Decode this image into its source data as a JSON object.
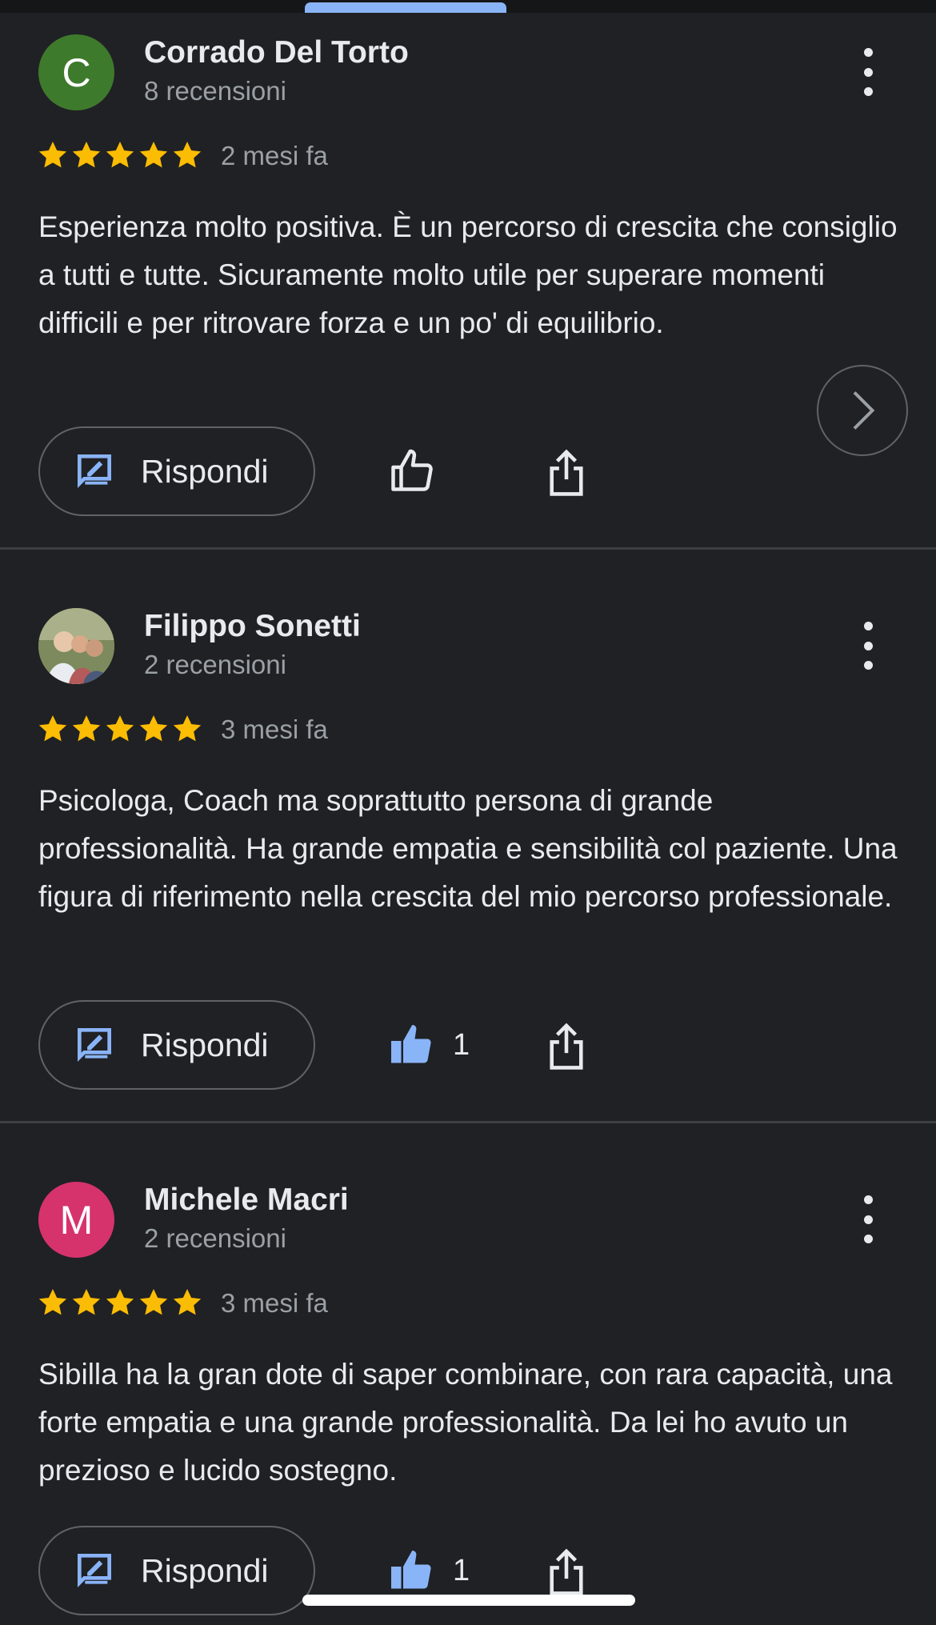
{
  "reviews": [
    {
      "name": "Corrado Del Torto",
      "subtitle": "8 recensioni",
      "avatar_letter": "C",
      "avatar_color": "#3e7a2c",
      "rating": 5,
      "date": "2 mesi fa",
      "text": "Esperienza molto positiva. È un percorso di crescita che consiglio a tutti e tutte. Sicuramente molto utile per superare momenti difficili e per ritrovare forza e un po' di equilibrio.",
      "reply_label": "Rispondi",
      "liked": false,
      "like_count": ""
    },
    {
      "name": "Filippo Sonetti",
      "subtitle": "2 recensioni",
      "avatar_letter": "",
      "avatar_color": "#8b7a5a",
      "rating": 5,
      "date": "3 mesi fa",
      "text": "Psicologa, Coach ma soprattutto persona di grande professionalità. Ha grande empatia e sensibilità col paziente. Una figura di riferimento nella crescita del mio percorso professionale.",
      "reply_label": "Rispondi",
      "liked": true,
      "like_count": "1"
    },
    {
      "name": "Michele Macri",
      "subtitle": "2 recensioni",
      "avatar_letter": "M",
      "avatar_color": "#d6336c",
      "rating": 5,
      "date": "3 mesi fa",
      "text": "Sibilla ha la gran dote di saper combinare, con rara capacità, una forte empatia e una grande professionalità. Da lei ho avuto un prezioso e lucido sostegno.",
      "reply_label": "Rispondi",
      "liked": true,
      "like_count": "1"
    }
  ],
  "colors": {
    "background": "#202124",
    "star": "#fbbc04",
    "accent": "#8ab4f8"
  },
  "icons": [
    "more-vert-icon",
    "star-icon",
    "reply-icon",
    "thumb-up-icon",
    "share-icon",
    "chevron-right-icon"
  ]
}
